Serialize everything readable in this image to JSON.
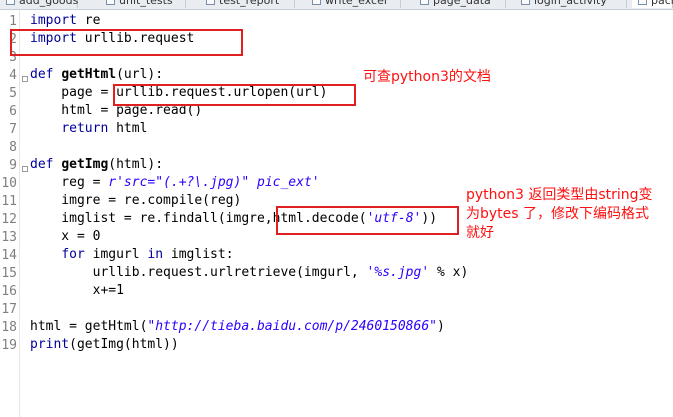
{
  "tabs": [
    {
      "label": "add_goods",
      "active": false
    },
    {
      "label": "unit_tests",
      "active": false
    },
    {
      "label": "test_report",
      "active": false
    },
    {
      "label": "write_excel",
      "active": false
    },
    {
      "label": "page_data",
      "active": false
    },
    {
      "label": "login_activity",
      "active": false
    },
    {
      "label": "pach",
      "active": true
    }
  ],
  "line_numbers": [
    "1",
    "2",
    "3",
    "4",
    "5",
    "6",
    "7",
    "8",
    "9",
    "10",
    "11",
    "12",
    "13",
    "14",
    "15",
    "16",
    "17",
    "18",
    "19"
  ],
  "code": {
    "l1": {
      "kw": "import",
      "rest": " re"
    },
    "l2": {
      "kw": "import",
      "rest": " urllib.request"
    },
    "l4": {
      "kw": "def",
      "name": "getHtml",
      "rest": "(url):"
    },
    "l5": {
      "pre": "    page = ",
      "boxed": "urllib.request.urlopen(url)"
    },
    "l6": {
      "text": "    html = page.read()"
    },
    "l7": {
      "pre": "    ",
      "kw": "return",
      "rest": " html"
    },
    "l9": {
      "kw": "def",
      "name": "getImg",
      "rest": "(html):"
    },
    "l10": {
      "pre": "    reg = ",
      "str": "r'src=\"(.+?\\.jpg)\" pic_ext'"
    },
    "l11": {
      "text": "    imgre = re.compile(reg)"
    },
    "l12": {
      "pre": "    imglist = re.findall(imgre,",
      "boxed_pre": "html.decode(",
      "str": "'utf-8'",
      "boxed_post": ")",
      "post": ")"
    },
    "l13": {
      "pre": "    x = ",
      "num": "0"
    },
    "l14": {
      "pre": "    ",
      "kw": "for",
      "mid": " imgurl ",
      "kw2": "in",
      "rest": " imglist:"
    },
    "l15": {
      "pre": "        urllib.request.urlretrieve(imgurl, ",
      "str": "'%s.jpg'",
      "rest": " % x)"
    },
    "l16": {
      "pre": "        x+=",
      "num": "1"
    },
    "l18": {
      "pre": "html = getHtml(",
      "str": "\"http://tieba.baidu.com/p/2460150866\"",
      "rest": ")"
    },
    "l19": {
      "kw": "print",
      "rest": "(getImg(html))"
    }
  },
  "annotations": {
    "note1": "可查python3的文档",
    "note2_line1": "python3 返回类型由string变",
    "note2_line2": "为bytes 了，修改下编码格式",
    "note2_line3": "就好"
  }
}
